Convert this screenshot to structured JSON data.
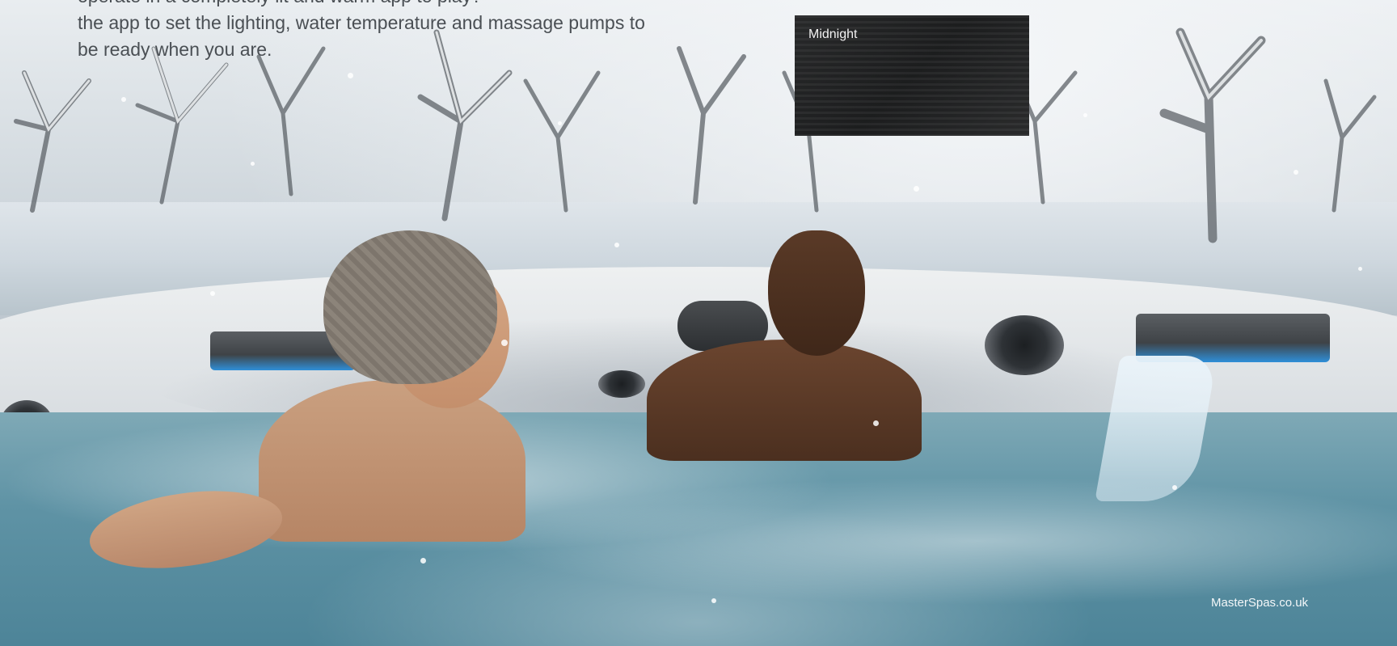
{
  "intro": {
    "line_cut": "operate in a completely lit and warm app to play?",
    "line_1": "the app to set the lighting, water temperature and massage pumps to",
    "line_2": "be ready when you are."
  },
  "swatch": {
    "label": "Midnight",
    "color": "#242526"
  },
  "footer": {
    "website": "MasterSpas.co.uk"
  },
  "colors": {
    "water": "#5f93a5",
    "accent_light": "#2f8fd8"
  }
}
